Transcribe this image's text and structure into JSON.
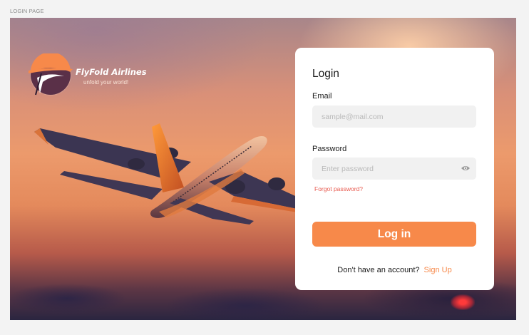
{
  "page": {
    "frame_label": "LOGIN PAGE"
  },
  "brand": {
    "name": "FlyFold Airlines",
    "tagline": "unfold your world!"
  },
  "login_form": {
    "title": "Login",
    "email_label": "Email",
    "email_placeholder": "sample@mail.com",
    "email_value": "",
    "password_label": "Password",
    "password_placeholder": "Enter password",
    "password_value": "",
    "forgot_password": "Forgot password?",
    "submit_label": "Log in",
    "signup_prompt": "Don't have an account?",
    "signup_link": "Sign Up"
  },
  "icons": {
    "password_toggle": "eye-icon",
    "logo": "airline-logo-icon"
  },
  "colors": {
    "accent": "#f7894a",
    "forgot_link": "#e85a4f",
    "input_background": "#f1f1f1",
    "card_background": "#ffffff"
  }
}
